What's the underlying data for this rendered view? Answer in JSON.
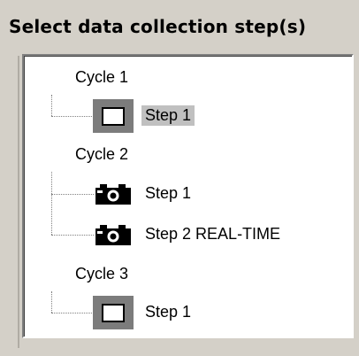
{
  "heading": "Select data collection step(s)",
  "tree": {
    "cycles": [
      {
        "label": "Cycle 1",
        "steps": [
          {
            "label": "Step 1",
            "icon": "frame-icon",
            "selected": true
          }
        ]
      },
      {
        "label": "Cycle 2",
        "steps": [
          {
            "label": "Step 1",
            "icon": "camera-icon",
            "selected": false
          },
          {
            "label": "Step 2 REAL-TIME",
            "icon": "camera-icon",
            "selected": false
          }
        ]
      },
      {
        "label": "Cycle 3",
        "steps": [
          {
            "label": "Step 1",
            "icon": "frame-icon",
            "selected": false
          }
        ]
      }
    ]
  },
  "colors": {
    "window_bg": "#d4d0c8",
    "panel_bg": "#ffffff",
    "selection_bg": "#c0c0c0",
    "icon_frame": "#7c7c7c"
  }
}
